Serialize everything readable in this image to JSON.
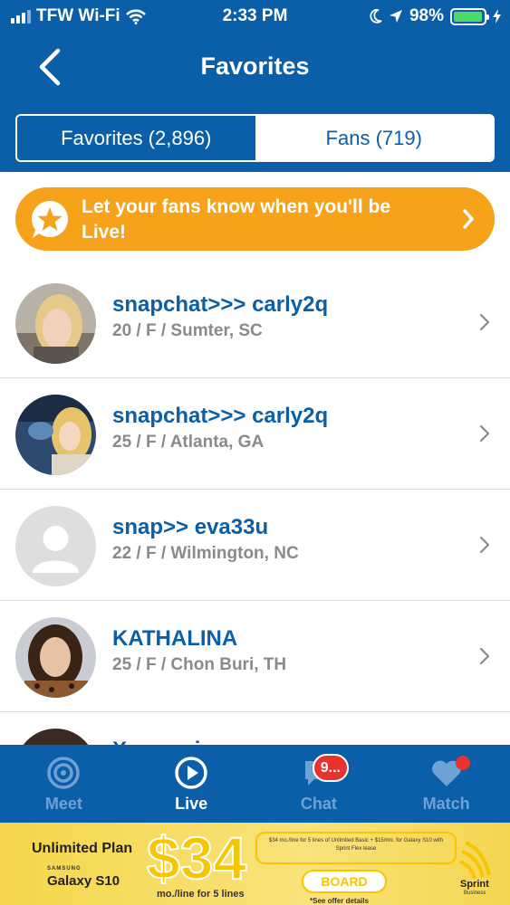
{
  "status_bar": {
    "carrier": "TFW Wi-Fi",
    "time": "2:33 PM",
    "battery": "98%",
    "battery_level": 0.98
  },
  "header": {
    "title": "Favorites",
    "back_icon": "chevron-left-icon"
  },
  "segmented": {
    "favorites_label": "Favorites (2,896)",
    "fans_label": "Fans (719)"
  },
  "banner": {
    "text": "Let your fans know when you'll be Live!",
    "icon": "star-bubble-icon"
  },
  "favorites": [
    {
      "name": "snapchat>>> carly2q",
      "details": "20 / F / Sumter, SC",
      "avatar": "photo"
    },
    {
      "name": "snapchat>>> carly2q",
      "details": "25 / F / Atlanta, GA",
      "avatar": "photo"
    },
    {
      "name": "snap>> eva33u",
      "details": "22 / F / Wilmington, NC",
      "avatar": "placeholder"
    },
    {
      "name": "KATHALINA",
      "details": "25 / F / Chon Buri, TH",
      "avatar": "photo"
    },
    {
      "name": "Xxxx.nain",
      "details": "",
      "avatar": "photo"
    }
  ],
  "tabbar": {
    "meet": "Meet",
    "live": "Live",
    "chat": "Chat",
    "chat_badge": "9...",
    "match": "Match"
  },
  "ad": {
    "plan": "Unlimited Plan",
    "brand": "SAMSUNG",
    "device": "Galaxy S10",
    "price": "$34",
    "per": "mo./line for 5 lines",
    "fine_print": "$34 mo./line for 5 lines of Unlimited Basic + $15/mo. for Galaxy S10 with Sprint Flex lease",
    "cta": "BOARD",
    "details": "*See offer details",
    "logo": "Sprint",
    "logo_sub": "Business"
  },
  "colors": {
    "brand_blue": "#0b5ea8",
    "banner_orange": "#f7a21b",
    "badge_red": "#e8322e"
  }
}
